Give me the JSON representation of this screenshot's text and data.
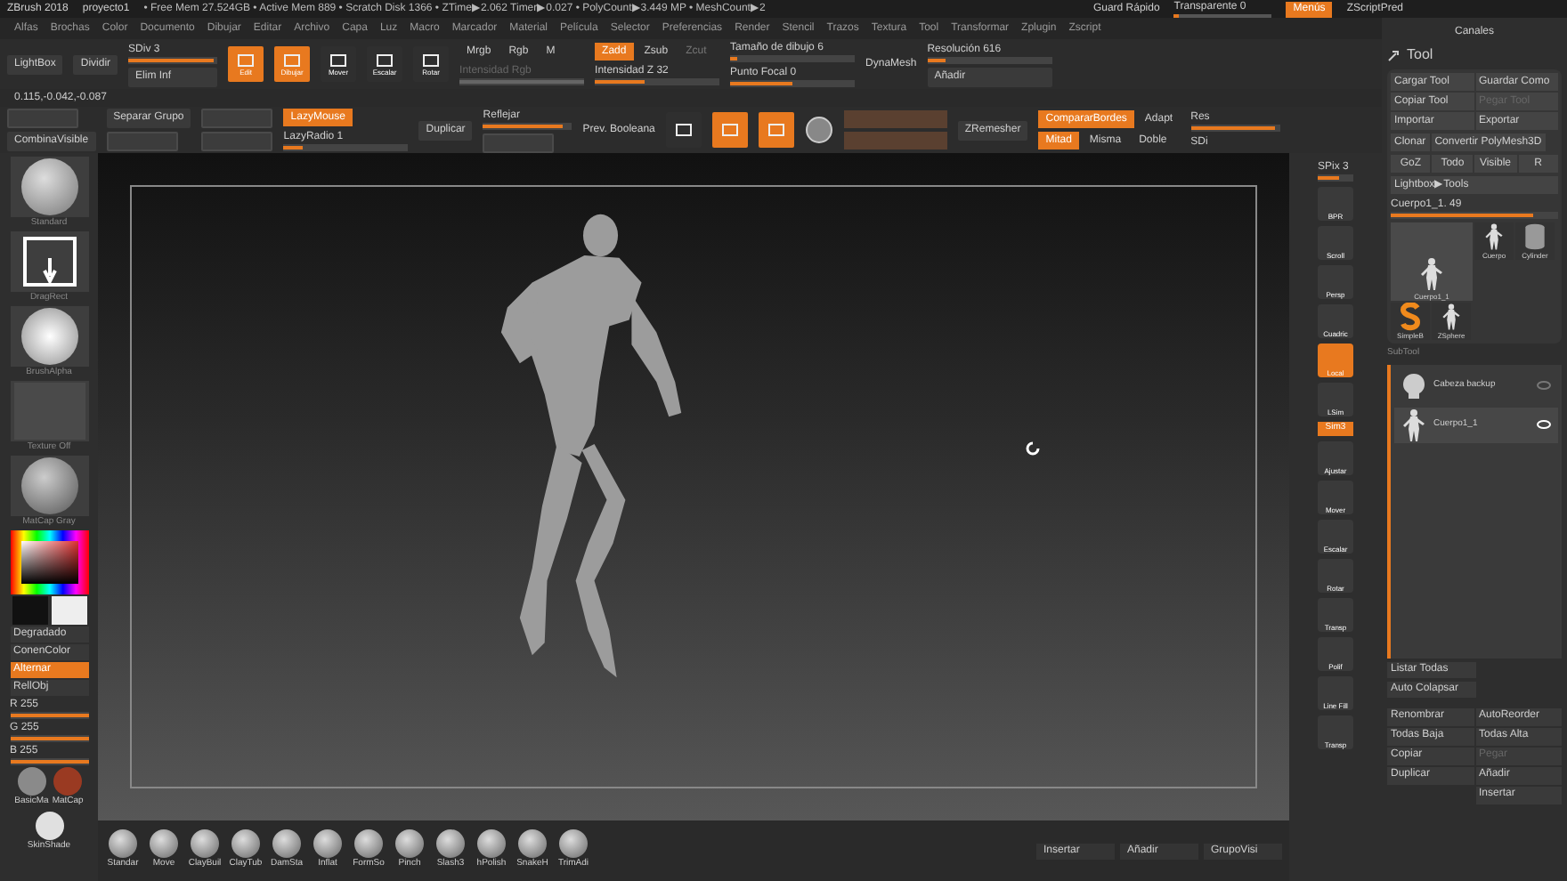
{
  "title_bar": {
    "app": "ZBrush 2018",
    "project": "proyecto1",
    "stats": "• Free Mem 27.524GB • Active Mem 889 • Scratch Disk 1366 • ZTime▶2.062 Timer▶0.027 • PolyCount▶3.449 MP • MeshCount▶2",
    "quick_save": "Guard Rápido",
    "transparency": {
      "label": "Transparente 0",
      "level": 0.05
    },
    "menus_toggle": {
      "label": "Menús",
      "selected": true
    },
    "script_button": "ZScriptPred"
  },
  "menu": [
    "Alfas",
    "Brochas",
    "Color",
    "Documento",
    "Dibujar",
    "Editar",
    "Archivo",
    "Capa",
    "Luz",
    "Macro",
    "Marcador",
    "Material",
    "Película",
    "Selector",
    "Preferencias",
    "Render",
    "Stencil",
    "Trazos",
    "Textura",
    "Tool",
    "Transformar",
    "Zplugin",
    "Zscript"
  ],
  "shelf_top": [
    [
      {
        "kind": "button",
        "label": "LightBox"
      }
    ],
    [
      {
        "kind": "button",
        "label": "Dividir"
      }
    ],
    [
      {
        "kind": "slider",
        "label": "SDiv 3",
        "level": 0.95,
        "disabled": false
      },
      {
        "kind": "button",
        "label": "Elim Inf"
      }
    ],
    [
      {
        "kind": "tool",
        "label": "Edit",
        "selected": true
      }
    ],
    [
      {
        "kind": "tool",
        "label": "Dibujar",
        "selected": true
      }
    ],
    [
      {
        "kind": "tool",
        "label": "Mover",
        "selected": false
      }
    ],
    [
      {
        "kind": "tool",
        "label": "Escalar",
        "selected": false
      }
    ],
    [
      {
        "kind": "tool",
        "label": "Rotar",
        "selected": false
      }
    ],
    [
      {
        "kind": "toggles",
        "items": [
          {
            "label": "Mrgb",
            "selected": false,
            "disabled": false
          },
          {
            "label": "Rgb",
            "selected": false,
            "disabled": false
          },
          {
            "label": "M",
            "selected": false,
            "disabled": false
          }
        ]
      },
      {
        "kind": "slider",
        "label": "Intensidad Rgb",
        "level": 1,
        "disabled": true
      }
    ],
    [
      {
        "kind": "toggles",
        "items": [
          {
            "label": "Zadd",
            "selected": true,
            "disabled": false
          },
          {
            "label": "Zsub",
            "selected": false,
            "disabled": false
          },
          {
            "label": "Zcut",
            "selected": false,
            "disabled": true
          }
        ]
      },
      {
        "kind": "slider",
        "label": "Intensidad Z 32",
        "level": 0.4,
        "disabled": false
      }
    ],
    [
      {
        "kind": "slider",
        "label": "Tamaño de dibujo 6",
        "level": 0.05,
        "disabled": false
      },
      {
        "kind": "slider",
        "label": "Punto Focal 0",
        "level": 0.5,
        "disabled": false
      }
    ],
    [
      {
        "kind": "label",
        "label": "DynaMesh"
      }
    ],
    [
      {
        "kind": "slider",
        "label": "Resolución 616",
        "level": 0.15,
        "disabled": false
      },
      {
        "kind": "button",
        "label": "Añadir"
      }
    ]
  ],
  "coordinates": "0.115,-0.042,-0.087",
  "shelf_bottom": [
    [
      {
        "kind": "blank"
      },
      {
        "kind": "button",
        "label": "CombinaVisible"
      }
    ],
    [
      {
        "kind": "button",
        "label": "Separar Grupo"
      },
      {
        "kind": "blank"
      }
    ],
    [
      {
        "kind": "blank"
      },
      {
        "kind": "blank"
      }
    ],
    [
      {
        "kind": "toggles",
        "items": [
          {
            "label": "LazyMouse",
            "selected": true,
            "disabled": false
          }
        ]
      },
      {
        "kind": "slider",
        "label": "LazyRadio 1",
        "level": 0.15,
        "disabled": false
      }
    ],
    [
      {
        "kind": "button",
        "label": "Duplicar"
      }
    ],
    [
      {
        "kind": "slider",
        "label": "Reflejar",
        "level": 0.9,
        "disabled": false
      },
      {
        "kind": "blank"
      }
    ],
    [
      {
        "kind": "label",
        "label": "Prev. Booleana"
      }
    ],
    [
      {
        "kind": "tool",
        "selected": false
      }
    ],
    [
      {
        "kind": "tool",
        "selected": true
      }
    ],
    [
      {
        "kind": "tool",
        "selected": true
      }
    ],
    [
      {
        "kind": "sphere"
      }
    ],
    [
      {
        "kind": "field"
      },
      {
        "kind": "field"
      }
    ],
    [
      {
        "kind": "button",
        "label": "ZRemesher"
      }
    ],
    [
      {
        "kind": "toggles",
        "items": [
          {
            "label": "CompararBordes",
            "selected": true,
            "disabled": false
          },
          {
            "label": "Adapt",
            "selected": false,
            "disabled": false
          }
        ]
      },
      {
        "kind": "toggles",
        "items": [
          {
            "label": "Mitad",
            "selected": true,
            "disabled": false
          },
          {
            "label": "Misma",
            "selected": false,
            "disabled": false
          },
          {
            "label": "Doble",
            "selected": false,
            "disabled": false
          }
        ]
      }
    ],
    [
      {
        "kind": "slider",
        "label": "Res",
        "level": 0.95,
        "disabled": false
      },
      {
        "kind": "label",
        "label": "SDi"
      }
    ]
  ],
  "left_panel": {
    "thumbnails": [
      {
        "label": "Standard",
        "kind": "brush"
      },
      {
        "label": "DragRect",
        "kind": "stroke"
      },
      {
        "label": "BrushAlpha",
        "kind": "alpha"
      },
      {
        "label": "Texture Off",
        "kind": "texture"
      },
      {
        "label": "MatCap Gray",
        "kind": "material"
      }
    ],
    "buttons": [
      {
        "label": "Degradado",
        "selected": false
      },
      {
        "label": "ConenColor",
        "selected": false
      },
      {
        "label": "Alternar",
        "selected": true
      },
      {
        "label": "RellObj",
        "selected": false
      }
    ],
    "sliders": [
      {
        "label": "R 255",
        "level": 1
      },
      {
        "label": "G 255",
        "level": 1
      },
      {
        "label": "B 255",
        "level": 1
      }
    ],
    "materials": [
      {
        "label": "BasicMa",
        "color": "#8a8a8a"
      },
      {
        "label": "MatCap",
        "color": "#9a3a22"
      },
      {
        "label": "SkinShade",
        "color": "#e0e0e0"
      }
    ]
  },
  "right_toolbar": [
    {
      "label": "SPix 3",
      "kind": "slider",
      "level": 0.6
    },
    {
      "label": "BPR",
      "kind": "button",
      "selected": false
    },
    {
      "label": "Scroll",
      "kind": "button",
      "selected": false
    },
    {
      "label": "Persp",
      "kind": "button",
      "selected": false
    },
    {
      "label": "Cuadric",
      "kind": "button",
      "selected": false
    },
    {
      "label": "Local",
      "kind": "button",
      "selected": true
    },
    {
      "label": "LSim",
      "kind": "button",
      "selected": false
    },
    {
      "label": "Sim3",
      "kind": "small",
      "selected": true
    },
    {
      "label": "Ajustar",
      "kind": "button",
      "selected": false
    },
    {
      "label": "Mover",
      "kind": "button",
      "selected": false
    },
    {
      "label": "Escalar",
      "kind": "button",
      "selected": false
    },
    {
      "label": "Rotar",
      "kind": "button",
      "selected": false
    },
    {
      "label": "Transp",
      "kind": "button",
      "selected": false
    },
    {
      "label": "Polif",
      "kind": "button",
      "selected": false
    },
    {
      "label": "Line Fill",
      "kind": "button",
      "selected": false
    },
    {
      "label": "Transp",
      "kind": "button",
      "selected": false
    }
  ],
  "right_panel": {
    "title": "Canales",
    "tool_title": "Tool",
    "tool_buttons": [
      {
        "label": "Cargar Tool",
        "disabled": false
      },
      {
        "label": "Guardar Como",
        "disabled": false
      },
      {
        "label": "Copiar Tool",
        "disabled": false
      },
      {
        "label": "Pegar Tool",
        "disabled": true
      },
      {
        "label": "Importar",
        "disabled": false
      },
      {
        "label": "Exportar",
        "disabled": false
      }
    ],
    "clone_buttons": [
      "Clonar",
      "Convertir PolyMesh3D"
    ],
    "goz_buttons": [
      "GoZ",
      "Todo",
      "Visible",
      "R"
    ],
    "lightbox": "Lightbox▶Tools",
    "current_tool": {
      "label": "Cuerpo1_1. 49",
      "level": 0.85
    },
    "tools": [
      {
        "label": "Cuerpo1_1",
        "kind": "figure",
        "selected": true
      },
      {
        "label": "Cuerpo",
        "kind": "figure",
        "selected": false
      },
      {
        "label": "Cylinder",
        "kind": "cylinder",
        "selected": false
      },
      {
        "label": "SimpleB",
        "kind": "s",
        "selected": false
      },
      {
        "label": "ZSphere",
        "kind": "figure",
        "selected": false
      }
    ],
    "subtool_title": "SubTool",
    "subtools": [
      {
        "label": "Cabeza backup",
        "kind": "head",
        "selected": false,
        "visible": false
      },
      {
        "label": "Cuerpo1_1",
        "kind": "figure",
        "selected": true,
        "visible": true
      }
    ],
    "list_buttons": [
      "Listar Todas",
      "Auto Colapsar"
    ],
    "action_buttons": [
      {
        "label": "Renombrar",
        "disabled": false
      },
      {
        "label": "AutoReorder",
        "disabled": false
      },
      {
        "label": "Todas Baja",
        "disabled": false
      },
      {
        "label": "Todas Alta",
        "disabled": false
      },
      {
        "label": "Copiar",
        "disabled": false
      },
      {
        "label": "Pegar",
        "disabled": true
      },
      {
        "label": "Duplicar",
        "disabled": false
      },
      {
        "label": "Añadir",
        "disabled": false
      }
    ],
    "insert_button": "Insertar"
  },
  "brush_strip": [
    "Standar",
    "Move",
    "ClayBuil",
    "ClayTub",
    "DamSta",
    "Inflat",
    "FormSo",
    "Pinch",
    "Slash3",
    "hPolish",
    "SnakeH",
    "TrimAdi"
  ],
  "bottom_buttons": [
    "Insertar",
    "Añadir",
    "GrupoVisi"
  ]
}
